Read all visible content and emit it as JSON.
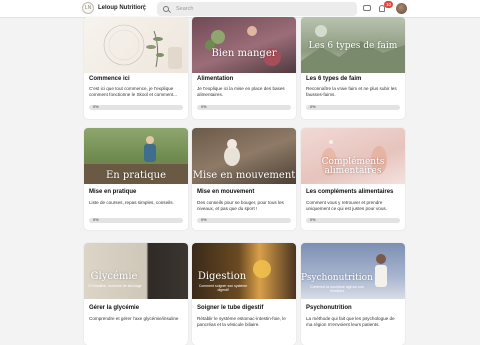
{
  "header": {
    "brand_name": "Leloup Nutrition",
    "brand_logo_text": "LN",
    "search_placeholder": "Search",
    "notification_count": "10"
  },
  "cards": [
    {
      "title": "Commence ici",
      "desc": "C'est ici que tout commence, je t'explique comment fonctionne le Skool et comment...",
      "progress": "0%",
      "thumb_text": "",
      "thumb_sub": ""
    },
    {
      "title": "Alimentation",
      "desc": "Je t'explique ici la mise en place des bases alimentaires.",
      "progress": "0%",
      "thumb_text": "Bien manger",
      "thumb_sub": ""
    },
    {
      "title": "Les 6 types de faim",
      "desc": "Reconnaître la vraie faim et ne plus subir les fausses-faims.",
      "progress": "0%",
      "thumb_text": "Les 6 types de faim",
      "thumb_sub": ""
    },
    {
      "title": "Mise en pratique",
      "desc": "Liste de courses, repas simples, conseils.",
      "progress": "0%",
      "thumb_text": "En pratique",
      "thumb_sub": ""
    },
    {
      "title": "Mise en mouvement",
      "desc": "Des conseils pour se bouger, pour tous les niveaux, et pas que du sport !",
      "progress": "0%",
      "thumb_text": "Mise en mouvement",
      "thumb_sub": ""
    },
    {
      "title": "Les compléments alimentaires",
      "desc": "Comment vous y retrouver et prendre uniquement ce qui est justes pour vous.",
      "progress": "0%",
      "thumb_text": "Compléments alimentaires",
      "thumb_sub": ""
    },
    {
      "title": "Gérer la glycémie",
      "desc": "Comprendre et gérer l'axe glycémie/insuline",
      "progress": "",
      "thumb_text": "Glycémie",
      "thumb_sub": "Et l'insuline, hormone de stockage"
    },
    {
      "title": "Soigner le tube digestif",
      "desc": "Rétablir le système estomac-intestin-foie, le pancréas et la vésicule biliaire.",
      "progress": "",
      "thumb_text": "Digestion",
      "thumb_sub": "Comment soigner son système digestif"
    },
    {
      "title": "Psychonutrition",
      "desc": "La méthode qui fait que les psychologue de ma région m'envoient leurs patients.",
      "progress": "",
      "thumb_text": "Psychonutrition",
      "thumb_sub": "Comment la nourriture agit sur nos émotions"
    }
  ]
}
